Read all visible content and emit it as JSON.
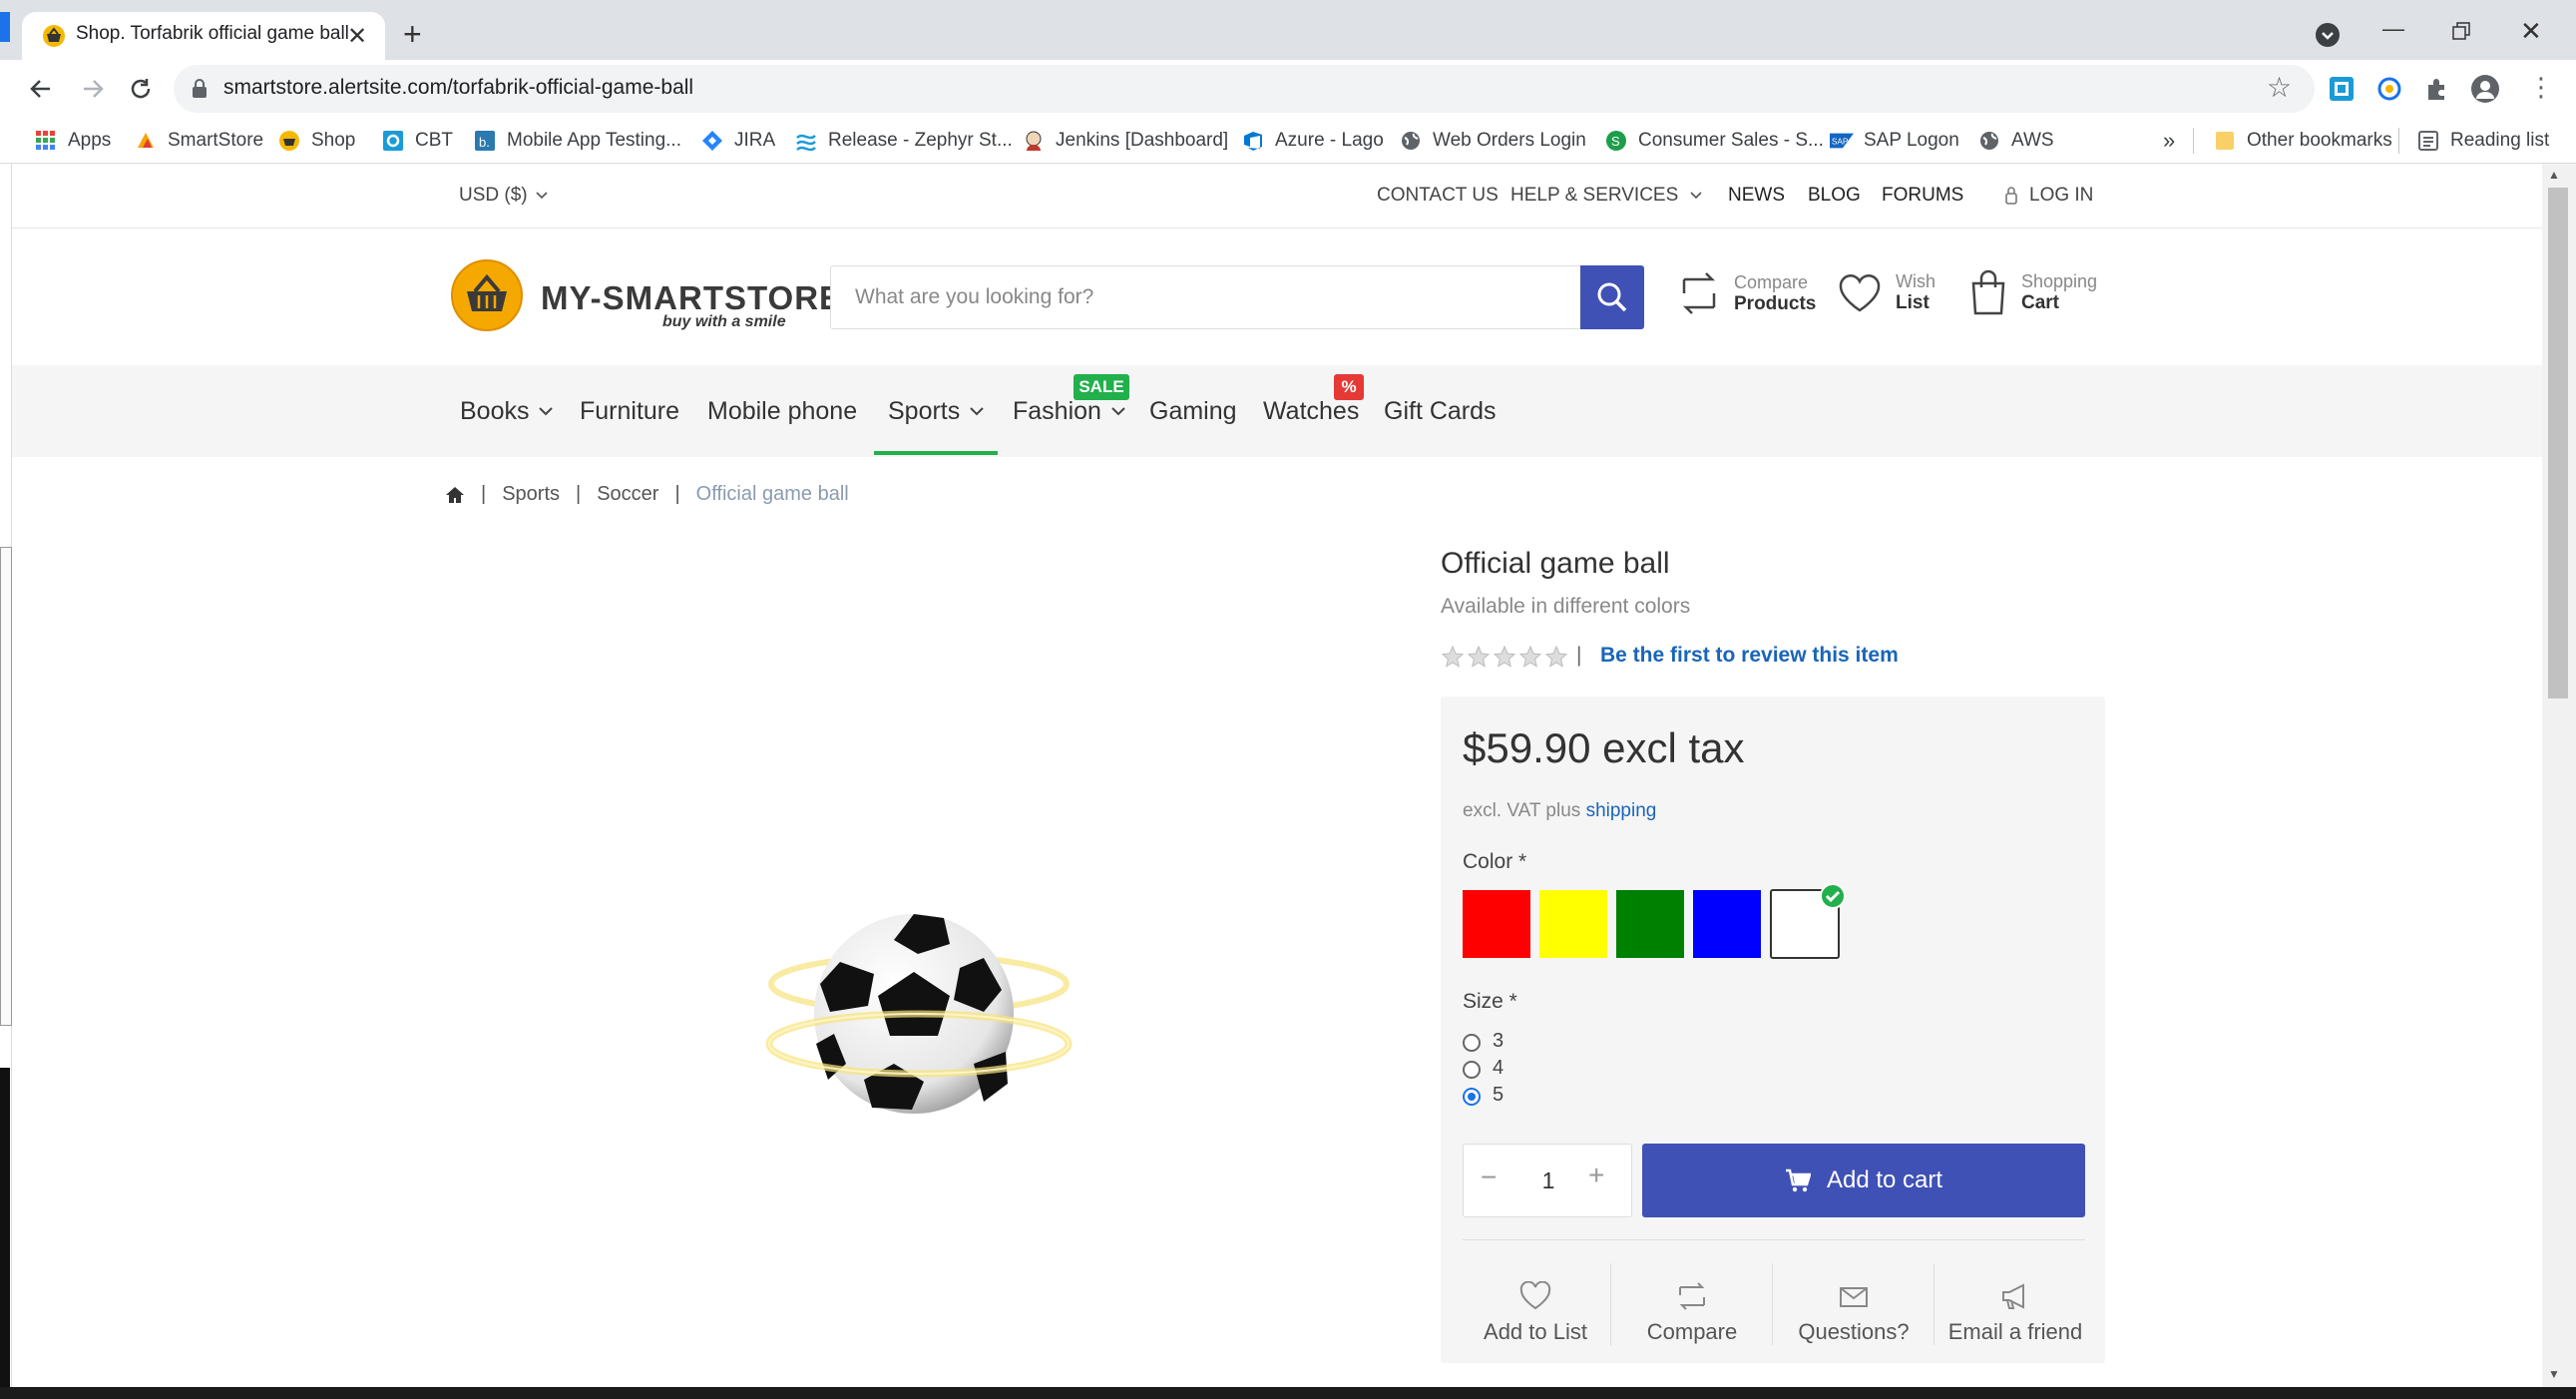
{
  "browser": {
    "tab_title": "Shop. Torfabrik official game ball",
    "url": "smartstore.alertsite.com/torfabrik-official-game-ball",
    "bookmarks": [
      "Apps",
      "SmartStore",
      "Shop",
      "CBT",
      "Mobile App Testing...",
      "JIRA",
      "Release - Zephyr St...",
      "Jenkins [Dashboard]",
      "Azure - Lago",
      "Web Orders Login",
      "Consumer Sales - S...",
      "SAP Logon",
      "AWS"
    ],
    "overflow": "»",
    "other_bookmarks": "Other bookmarks",
    "reading_list": "Reading list"
  },
  "topbar": {
    "currency": "USD ($)",
    "contact": "CONTACT US",
    "help": "HELP & SERVICES",
    "news": "NEWS",
    "blog": "BLOG",
    "forums": "FORUMS",
    "login": "LOG IN"
  },
  "header": {
    "logo_main": "MY-SMARTSTORE",
    "logo_tag": "buy with a smile",
    "search_placeholder": "What are you looking for?",
    "compare_top": "Compare",
    "compare_bottom": "Products",
    "wish_top": "Wish",
    "wish_bottom": "List",
    "cart_top": "Shopping",
    "cart_bottom": "Cart"
  },
  "nav": {
    "items": [
      "Books",
      "Furniture",
      "Mobile phone",
      "Sports",
      "Fashion",
      "Gaming",
      "Watches",
      "Gift Cards"
    ],
    "sale_badge": "SALE",
    "percent_badge": "%",
    "active": "Sports"
  },
  "breadcrumb": {
    "items": [
      "Sports",
      "Soccer",
      "Official game ball"
    ],
    "separator": "|"
  },
  "product": {
    "title": "Official game ball",
    "subtitle": "Available in different colors",
    "rating": 0,
    "rating_max": 5,
    "review_link": "Be the first to review this item",
    "price": "$59.90 excl tax",
    "tax_note": "excl. VAT plus",
    "shipping_link": "shipping",
    "color_label": "Color *",
    "colors": [
      "#ff0000",
      "#ffff00",
      "#008000",
      "#0000ff",
      "#ffffff"
    ],
    "selected_color_index": 4,
    "size_label": "Size *",
    "sizes": [
      "3",
      "4",
      "5"
    ],
    "selected_size": "5",
    "quantity": "1",
    "add_to_cart": "Add to cart",
    "actions": [
      "Add to List",
      "Compare",
      "Questions?",
      "Email a friend"
    ]
  },
  "theme": {
    "primary": "#3f51b5",
    "link": "#1a65b8",
    "sale": "#21b04b",
    "badge_red": "#e53935"
  }
}
